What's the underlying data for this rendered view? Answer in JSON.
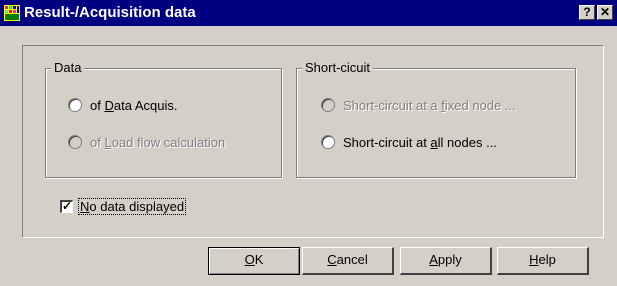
{
  "window": {
    "title": "Result-/Acquisition data",
    "help_glyph": "?",
    "close_glyph": "✕"
  },
  "groups": {
    "data": {
      "legend": "Data",
      "options": [
        {
          "prefix": "of ",
          "accel": "D",
          "rest": "ata Acquis.",
          "checked": false,
          "enabled": true
        },
        {
          "prefix": "of ",
          "accel": "L",
          "rest": "oad flow calculation",
          "checked": false,
          "enabled": false
        }
      ]
    },
    "short_circuit": {
      "legend": "Short-cicuit",
      "options": [
        {
          "prefix": "Short-circuit at a ",
          "accel": "f",
          "rest": "ixed node ...",
          "checked": false,
          "enabled": false
        },
        {
          "prefix": "Short-circuit at ",
          "accel": "a",
          "rest": "ll nodes ...",
          "checked": false,
          "enabled": true
        }
      ]
    }
  },
  "checkbox": {
    "accel": "N",
    "rest": "o data displayed",
    "checked": true
  },
  "buttons": {
    "ok": {
      "accel": "O",
      "rest": "K"
    },
    "cancel": {
      "accel": "C",
      "rest": "ancel"
    },
    "apply": {
      "accel": "A",
      "rest": "pply"
    },
    "help": {
      "accel": "H",
      "rest": "elp"
    }
  },
  "icons": {
    "app": "app-grid-icon",
    "radio": "radio-button-icon",
    "check": "checkmark-icon"
  }
}
